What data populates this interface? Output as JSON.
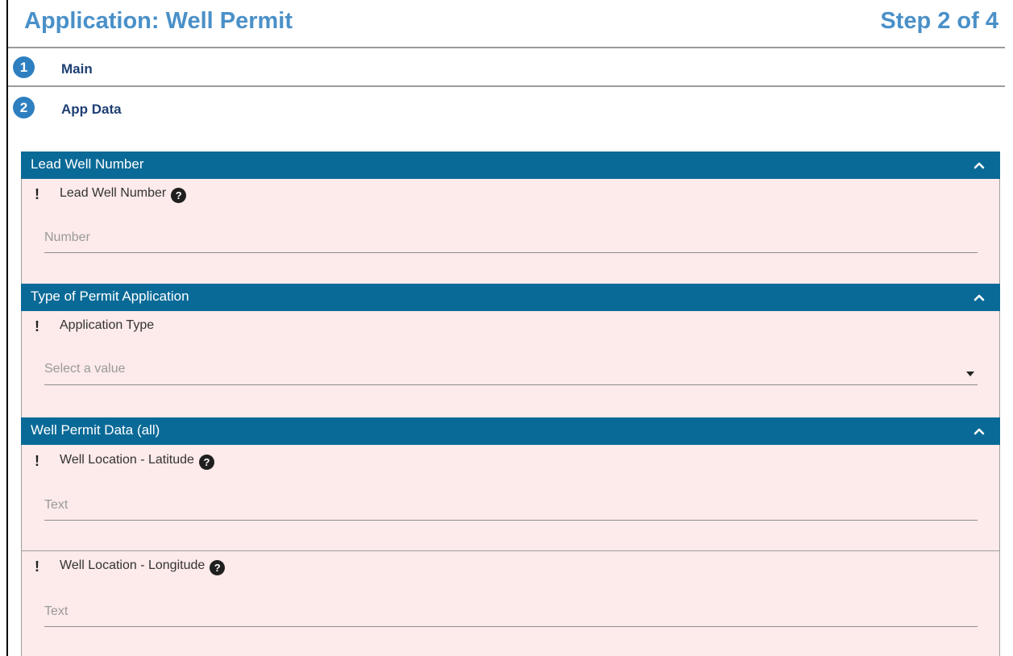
{
  "header": {
    "title": "Application: Well Permit",
    "step": "Step 2 of 4"
  },
  "steps": [
    {
      "number": "1",
      "label": "Main"
    },
    {
      "number": "2",
      "label": "App Data"
    }
  ],
  "sections": [
    {
      "title": "Lead Well Number",
      "fields": [
        {
          "required_mark": "!",
          "label": "Lead Well Number",
          "help": "?",
          "placeholder": "Number"
        }
      ]
    },
    {
      "title": "Type of Permit Application",
      "fields": [
        {
          "required_mark": "!",
          "label": "Application Type",
          "placeholder": "Select a value"
        }
      ]
    },
    {
      "title": "Well Permit Data (all)",
      "fields": [
        {
          "required_mark": "!",
          "label": "Well Location - Latitude",
          "help": "?",
          "placeholder": "Text"
        },
        {
          "required_mark": "!",
          "label": "Well Location - Longitude",
          "help": "?",
          "placeholder": "Text"
        }
      ]
    }
  ],
  "colors": {
    "title": "#4a90c8",
    "step_badge": "#2e7fc0",
    "step_label": "#1e3f73",
    "section_header": "#0a6a97",
    "required_bg": "#fdeaea"
  },
  "icons": {
    "collapse": "chevron-up-icon",
    "help": "question-circle-icon",
    "dropdown": "caret-down-icon",
    "required": "exclamation-icon"
  }
}
